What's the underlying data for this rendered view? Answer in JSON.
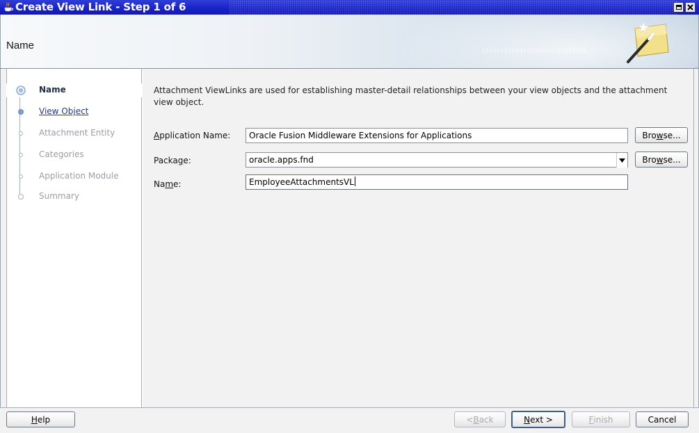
{
  "window": {
    "title": "Create View Link - Step 1 of 6"
  },
  "header": {
    "heading": "Name",
    "binary_text": "0101010101010101010101010101"
  },
  "steps": [
    {
      "label": "Name",
      "state": "current"
    },
    {
      "label": "View Object",
      "state": "link"
    },
    {
      "label": "Attachment Entity",
      "state": "disabled"
    },
    {
      "label": "Categories",
      "state": "disabled"
    },
    {
      "label": "Application Module",
      "state": "disabled"
    },
    {
      "label": "Summary",
      "state": "disabled"
    }
  ],
  "main": {
    "description": "Attachment ViewLinks are used for establishing master-detail relationships between your view objects and the attachment view object.",
    "application_name": {
      "label_pre": "",
      "label_mnemonic": "A",
      "label_post": "pplication Name:",
      "value": "Oracle Fusion Middleware Extensions for Applications",
      "browse_pre": "Bro",
      "browse_mnemonic": "w",
      "browse_post": "se..."
    },
    "package": {
      "label_pre": "Packa",
      "label_mnemonic": "g",
      "label_post": "e:",
      "value": "oracle.apps.fnd",
      "browse_pre": "Bro",
      "browse_mnemonic": "w",
      "browse_post": "se..."
    },
    "name": {
      "label_pre": "Na",
      "label_mnemonic": "m",
      "label_post": "e:",
      "value": "EmployeeAttachmentsVL"
    }
  },
  "footer": {
    "help": {
      "mnemonic": "H",
      "rest": "elp"
    },
    "back": {
      "pre": "< ",
      "mnemonic": "B",
      "rest": "ack"
    },
    "next": {
      "mnemonic": "N",
      "rest": "ext >"
    },
    "finish": {
      "mnemonic": "F",
      "rest": "inish"
    },
    "cancel": "Cancel"
  },
  "colors": {
    "titlebar": "#1a24c9",
    "link": "#1f3a8a",
    "disabled": "#9a9ea4"
  }
}
